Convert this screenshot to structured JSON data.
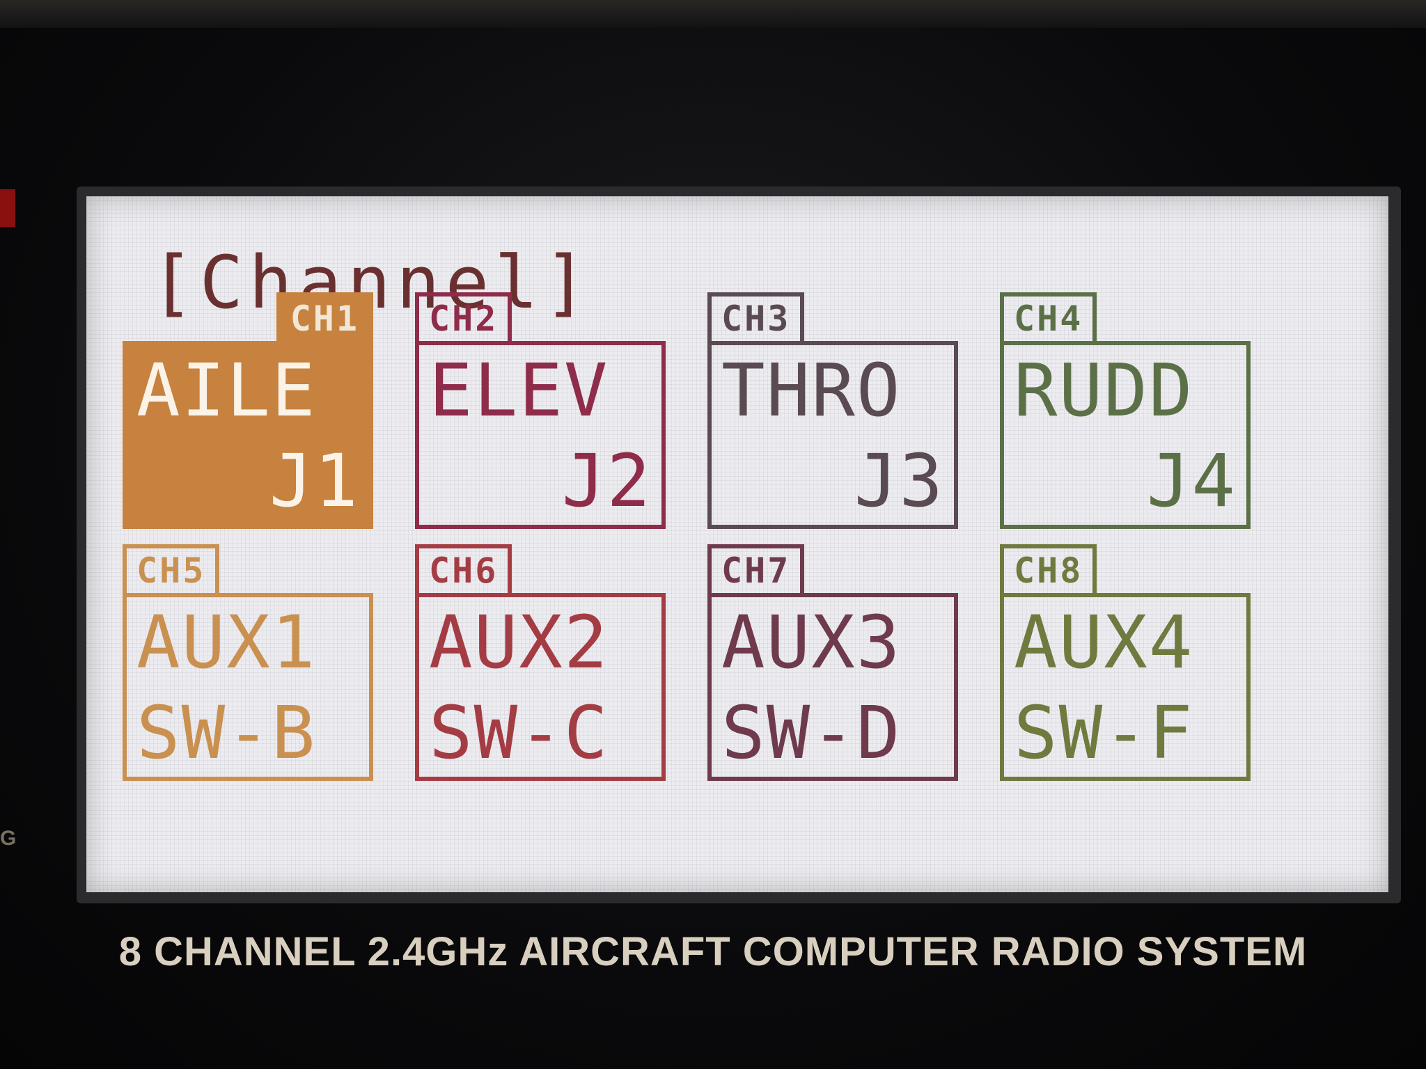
{
  "screen": {
    "title": "[Channel]"
  },
  "colors": {
    "lcd_background": "#ececf0",
    "selected_fill": "#c6823e"
  },
  "channels": [
    {
      "tag": "CH1",
      "function": "AILE",
      "source": "J1",
      "color": "#c6823e",
      "selected": true
    },
    {
      "tag": "CH2",
      "function": "ELEV",
      "source": "J2",
      "color": "#8e2c4a",
      "selected": false
    },
    {
      "tag": "CH3",
      "function": "THRO",
      "source": "J3",
      "color": "#5a4a52",
      "selected": false
    },
    {
      "tag": "CH4",
      "function": "RUDD",
      "source": "J4",
      "color": "#5c7048",
      "selected": false
    },
    {
      "tag": "CH5",
      "function": "AUX1",
      "source": "SW-B",
      "color": "#c99050",
      "selected": false
    },
    {
      "tag": "CH6",
      "function": "AUX2",
      "source": "SW-C",
      "color": "#a43c44",
      "selected": false
    },
    {
      "tag": "CH7",
      "function": "AUX3",
      "source": "SW-D",
      "color": "#6e3a4c",
      "selected": false
    },
    {
      "tag": "CH8",
      "function": "AUX4",
      "source": "SW-F",
      "color": "#6e7a3e",
      "selected": false
    }
  ],
  "device": {
    "caption": "8 CHANNEL 2.4GHz AIRCRAFT COMPUTER RADIO SYSTEM",
    "edge_letter": "G"
  }
}
